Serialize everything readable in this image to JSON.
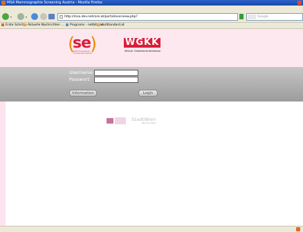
{
  "window": {
    "title": "MSA Mammographie Screening Austria - Mozilla Firefox"
  },
  "menu": {
    "items": [
      "Datei",
      "Bearbeiten",
      "Ansicht",
      "Chronik",
      "Lesezeichen",
      "Extras",
      "Hilfe"
    ]
  },
  "nav": {
    "url": "http://msa.dev.netcare.at/portal/overview.php?",
    "search_placeholder": "Google"
  },
  "bookmarks": {
    "items": [
      "Erste Schritte",
      "Aktuelle Nachrichten ...",
      "Programs - netbitstar ...",
      "derStandard.at"
    ]
  },
  "logos": {
    "left_text": "se",
    "left_sub": "Mammographie Screening Austria",
    "right_text": "WGKK",
    "right_sub": "Wiener Gebietskrankenkasse"
  },
  "login": {
    "username_label": "Username:",
    "password_label": "Passwort:",
    "info_button": "Information",
    "login_button": "Login"
  },
  "footer": {
    "city_logo": "StadtWien",
    "city_sub": "Wien ist anders"
  },
  "colors": {
    "banner_bg": "#fde8f0",
    "brand_red": "#d7203c",
    "brand_orange": "#f08a00"
  }
}
